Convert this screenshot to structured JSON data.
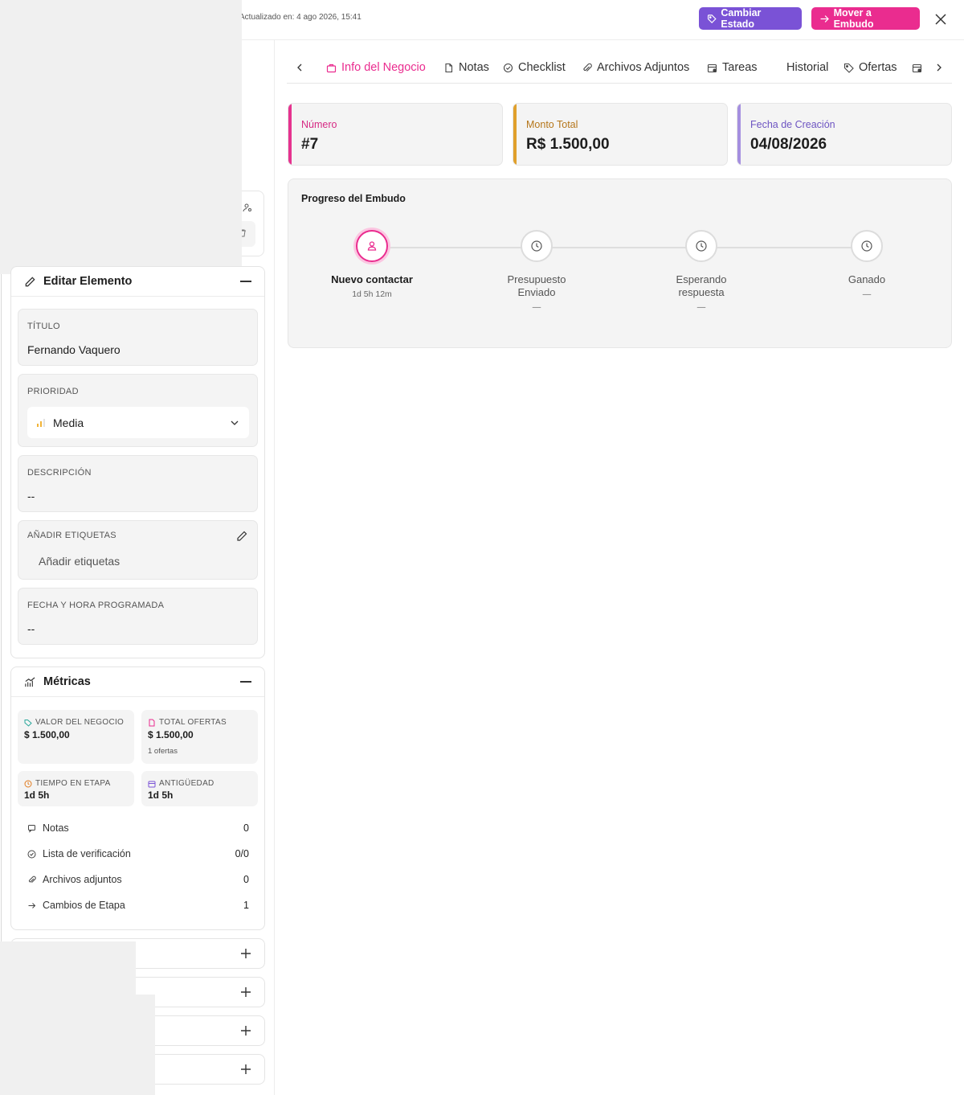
{
  "header": {
    "updated": "Actualizado en: 4 ago 2026, 15:41",
    "cambiar_estado": "Cambiar Estado",
    "mover_embudo": "Mover a Embudo"
  },
  "edit_panel": {
    "title": "Editar Elemento",
    "titulo_label": "TÍTULO",
    "titulo_value": "Fernando Vaquero",
    "prioridad_label": "PRIORIDAD",
    "prioridad_value": "Media",
    "descripcion_label": "DESCRIPCIÓN",
    "descripcion_value": "--",
    "etiquetas_label": "AÑADIR ETIQUETAS",
    "etiquetas_placeholder": "Añadir etiquetas",
    "fecha_label": "FECHA Y HORA PROGRAMADA",
    "fecha_value": "--"
  },
  "metrics": {
    "title": "Métricas",
    "cards": [
      {
        "label": "VALOR DEL NEGOCIO",
        "value": "$ 1.500,00",
        "sub": ""
      },
      {
        "label": "TOTAL OFERTAS",
        "value": "$ 1.500,00",
        "sub": "1 ofertas"
      },
      {
        "label": "TIEMPO EN ETAPA",
        "value": "1d 5h",
        "sub": ""
      },
      {
        "label": "ANTIGÜEDAD",
        "value": "1d 5h",
        "sub": ""
      }
    ],
    "rows": [
      {
        "label": "Notas",
        "value": "0"
      },
      {
        "label": "Lista de verificación",
        "value": "0/0"
      },
      {
        "label": "Archivos adjuntos",
        "value": "0"
      },
      {
        "label": "Cambios de Etapa",
        "value": "1"
      }
    ]
  },
  "tabs": [
    {
      "label": "Info del Negocio",
      "icon": "bag-icon"
    },
    {
      "label": "Notas",
      "icon": "document-icon"
    },
    {
      "label": "Checklist",
      "icon": "check-circle-icon"
    },
    {
      "label": "Archivos Adjuntos",
      "icon": "paperclip-icon"
    },
    {
      "label": "Tareas",
      "icon": "calendar-icon"
    },
    {
      "label": "Historial",
      "icon": ""
    },
    {
      "label": "Ofertas",
      "icon": "tag-icon"
    }
  ],
  "stats": [
    {
      "label": "Número",
      "value": "#7",
      "color": "#e6338f"
    },
    {
      "label": "Monto Total",
      "value": "R$ 1.500,00",
      "color": "#e0a02c"
    },
    {
      "label": "Fecha de Creación",
      "value": "04/08/2026",
      "color": "#a58fe0"
    }
  ],
  "progress": {
    "title": "Progreso del Embudo",
    "stages": [
      {
        "name": "Nuevo contactar",
        "time": "1d 5h 12m",
        "active": true
      },
      {
        "name": "Presupuesto Enviado",
        "time": "—",
        "active": false
      },
      {
        "name": "Esperando respuesta",
        "time": "—",
        "active": false
      },
      {
        "name": "Ganado",
        "time": "—",
        "active": false
      }
    ]
  },
  "colors": {
    "accent_pink": "#ea2c8f",
    "accent_purple": "#7a52d6"
  }
}
